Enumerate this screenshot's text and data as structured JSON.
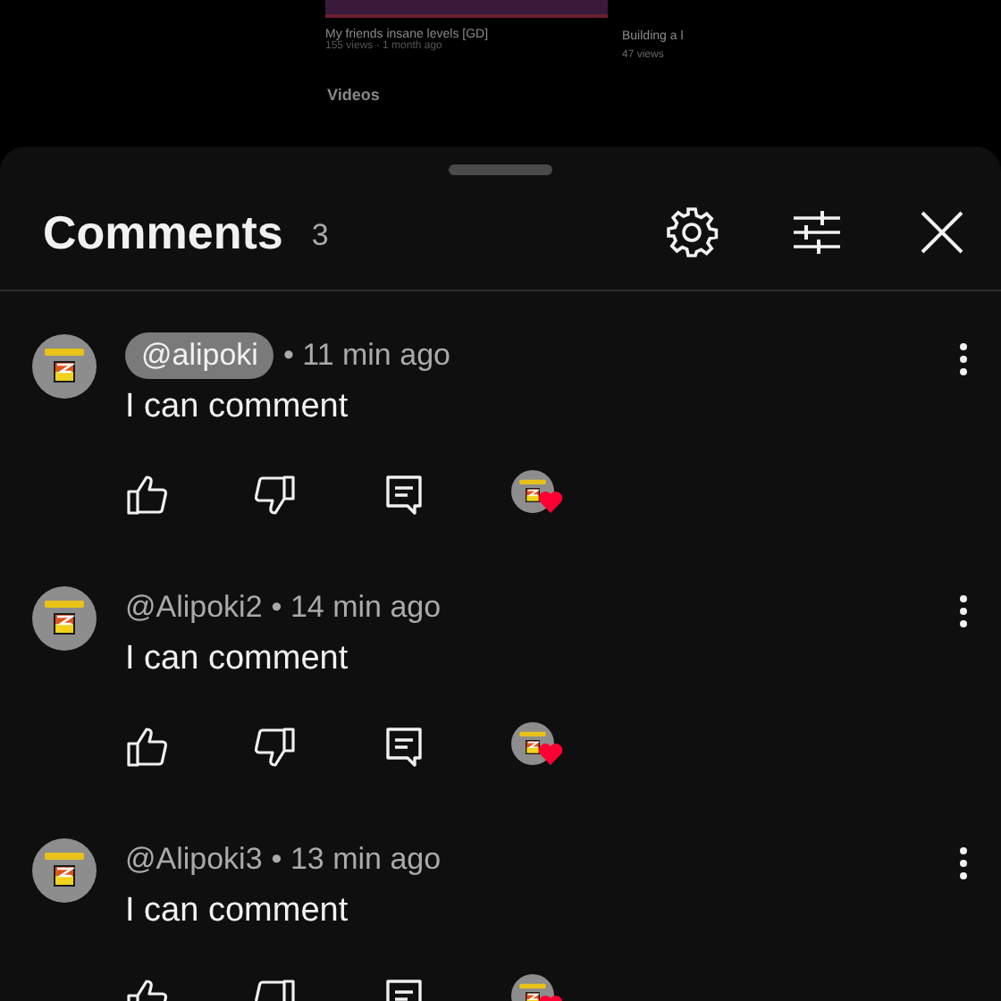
{
  "background": {
    "video_title": "My friends insane levels [GD]",
    "video_meta": "155 views · 1 month ago",
    "side_title": "Building a l",
    "side_meta": "47 views",
    "section": "Videos"
  },
  "header": {
    "title": "Comments",
    "count": "3"
  },
  "comments": [
    {
      "author": "@alipoki",
      "highlighted": true,
      "time": "• 11 min ago",
      "text": "I can comment",
      "hearted": true
    },
    {
      "author": "@Alipoki2",
      "highlighted": false,
      "time": "• 14 min ago",
      "text": "I can comment",
      "hearted": true
    },
    {
      "author": "@Alipoki3",
      "highlighted": false,
      "time": "• 13 min ago",
      "text": "I can comment",
      "hearted": true
    }
  ]
}
